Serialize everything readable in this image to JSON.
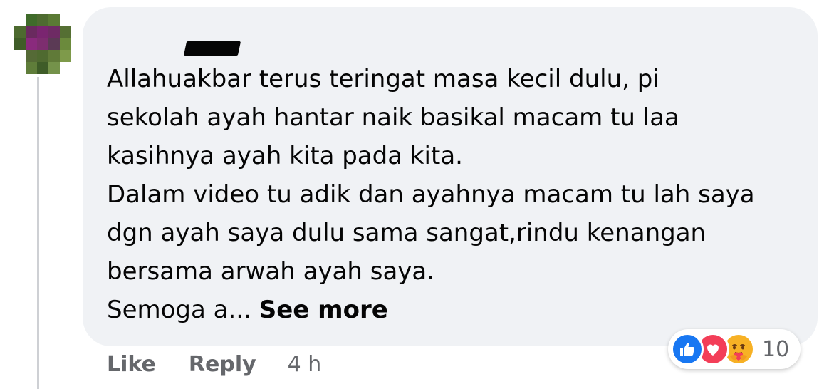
{
  "comment": {
    "lines": [
      "Allahuakbar terus teringat masa kecil dulu, pi",
      "sekolah ayah hantar naik basikal macam tu laa",
      "kasihnya ayah kita pada kita.",
      "Dalam video tu adik dan ayahnya macam tu lah saya",
      "dgn ayah saya dulu sama sangat,rindu kenangan",
      "bersama arwah ayah saya."
    ],
    "truncated_text": "Semoga a...",
    "see_more_label": "See more"
  },
  "reactions": {
    "icons": [
      "like-icon",
      "love-icon",
      "care-icon"
    ],
    "count": "10",
    "colors": {
      "like": "#1877f2",
      "love": "#f33e58",
      "care": "#f7b125"
    }
  },
  "actions": {
    "like_label": "Like",
    "reply_label": "Reply",
    "timestamp": "4 h"
  },
  "colors": {
    "bubble_background": "#f0f2f5",
    "text": "#050505",
    "secondary_text": "#65676b"
  }
}
